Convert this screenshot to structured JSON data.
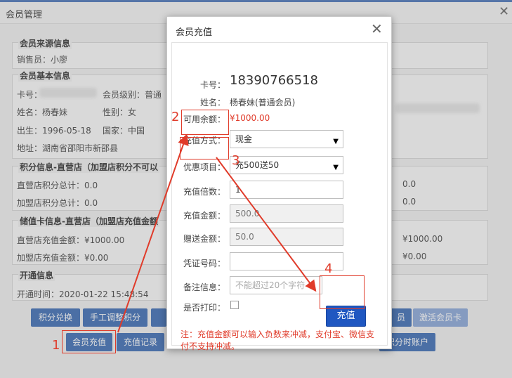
{
  "background_window": {
    "title": "会员管理",
    "sections": {
      "source": {
        "legend": "会员来源信息",
        "salesperson": "销售员：小廖"
      },
      "basic": {
        "legend": "会员基本信息",
        "card_no": "卡号：",
        "level": "会员级别：普通",
        "name": "姓名：杨春妹",
        "gender": "性别：女",
        "birth": "出生：1996-05-18",
        "country": "国家：中国",
        "address": "地址：湖南省邵阳市新邵县"
      },
      "points": {
        "legend": "积分信息-直营店（加盟店积分不可以",
        "direct": "直营店积分总计：0.0",
        "franchise": "加盟店积分总计：0.0",
        "right_1": "0.0",
        "right_2": "0.0"
      },
      "stored": {
        "legend": "储值卡信息-直营店（加盟店充值金额",
        "direct": "直营店充值金额：¥1000.00",
        "franchise": "加盟店充值金额：¥0.00",
        "right_1": "¥1000.00",
        "right_2": "¥0.00"
      },
      "open": {
        "legend": "开通信息",
        "time": "开通时间：2020-01-22 15:48:54"
      }
    },
    "buttons_row1": [
      "积分兑换",
      "手工调整积分",
      "员",
      "激活会员卡"
    ],
    "buttons_row2": [
      "会员充值",
      "充值记录",
      "积分时账户"
    ]
  },
  "dialog": {
    "title": "会员充值",
    "card_no_label": "卡号：",
    "card_no": "18390766518",
    "name_label": "姓名：",
    "name": "杨春妹(普通会员)",
    "balance_label": "可用余额：",
    "balance": "¥1000.00",
    "method_label": "充值方式：",
    "method_value": "现金",
    "promo_label": "优惠项目：",
    "promo_value": "充500送50",
    "multiple_label": "充值倍数：",
    "multiple_value": "1",
    "amount_label": "充值金额：",
    "amount_value": "500.0",
    "bonus_label": "赠送金额：",
    "bonus_value": "50.0",
    "voucher_label": "凭证号码：",
    "voucher_value": "",
    "remark_label": "备注信息：",
    "remark_placeholder": "不能超过20个字符",
    "print_label": "是否打印：",
    "confirm_label": "充值",
    "note": "注：充值金额可以输入负数来冲减，支付宝、微信支付不支持冲减。"
  },
  "annotations": {
    "step1": "1",
    "step2": "2",
    "step3": "3",
    "step4": "4"
  },
  "colors": {
    "accent": "#1f57c1",
    "annotation_red": "#e03b2a",
    "balance_red": "#e03b2a"
  }
}
